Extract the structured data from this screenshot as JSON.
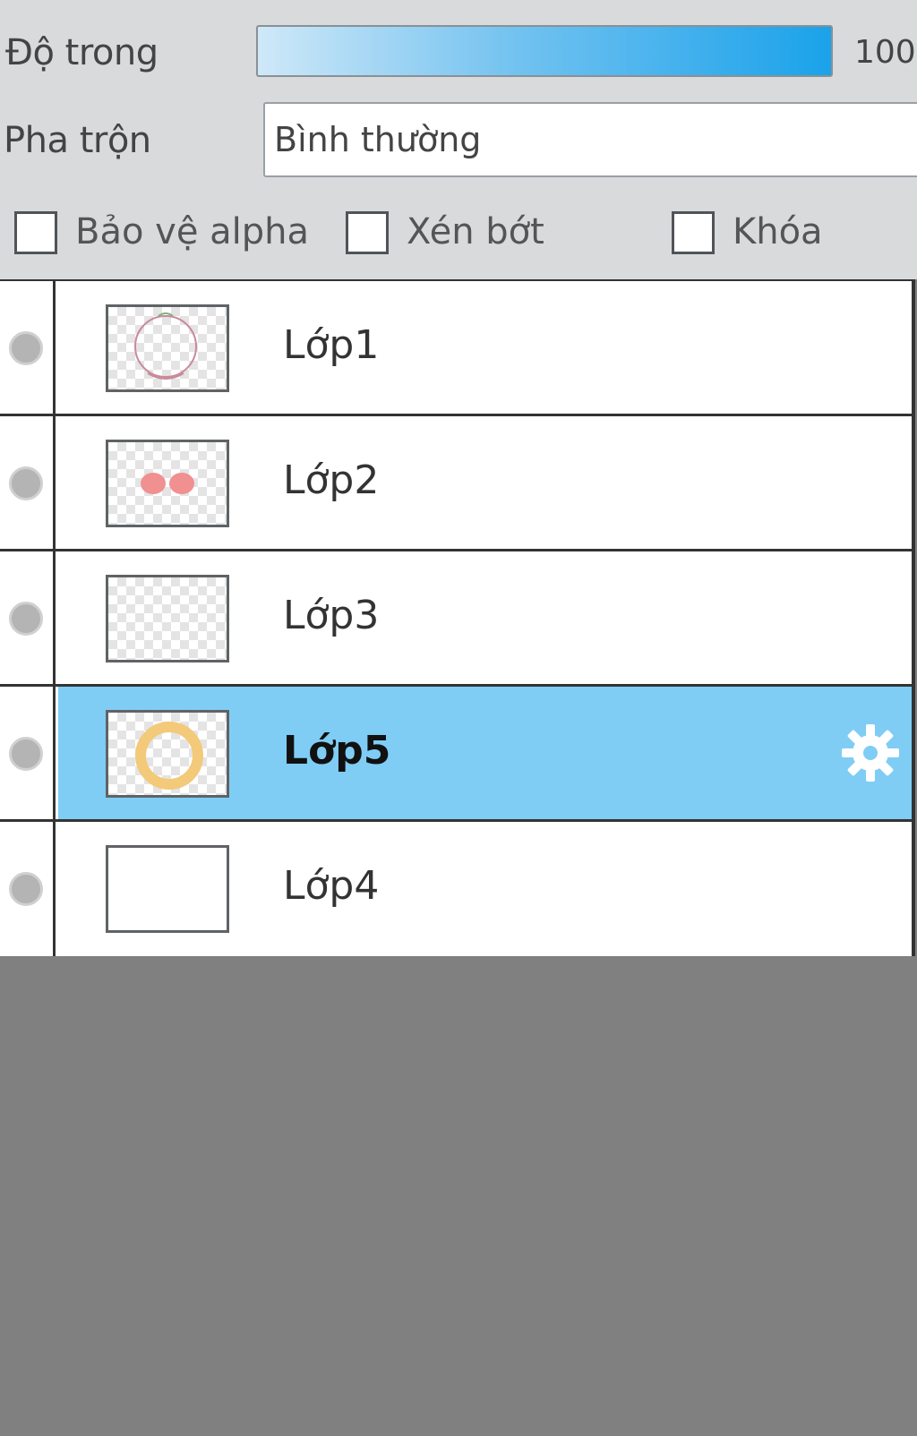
{
  "properties": {
    "opacity_label": "Độ trong",
    "opacity_value": "100",
    "opacity_level": 100,
    "blend_label": "Pha trộn",
    "blend_value": "Bình thường"
  },
  "checkboxes": {
    "protect_alpha": "Bảo vệ alpha",
    "clipping": "Xén bớt",
    "lock": "Khóa"
  },
  "layers": [
    {
      "name": "Lớp1",
      "selected": false
    },
    {
      "name": "Lớp2",
      "selected": false
    },
    {
      "name": "Lớp3",
      "selected": false
    },
    {
      "name": "Lớp5",
      "selected": true
    },
    {
      "name": "Lớp4",
      "selected": false
    }
  ],
  "colors": {
    "selected_row": "#7fcdf4",
    "opacity_bar_end": "#1aa2ea"
  },
  "icons": {
    "visibility": "visibility-dot-icon",
    "settings": "gear-icon"
  }
}
